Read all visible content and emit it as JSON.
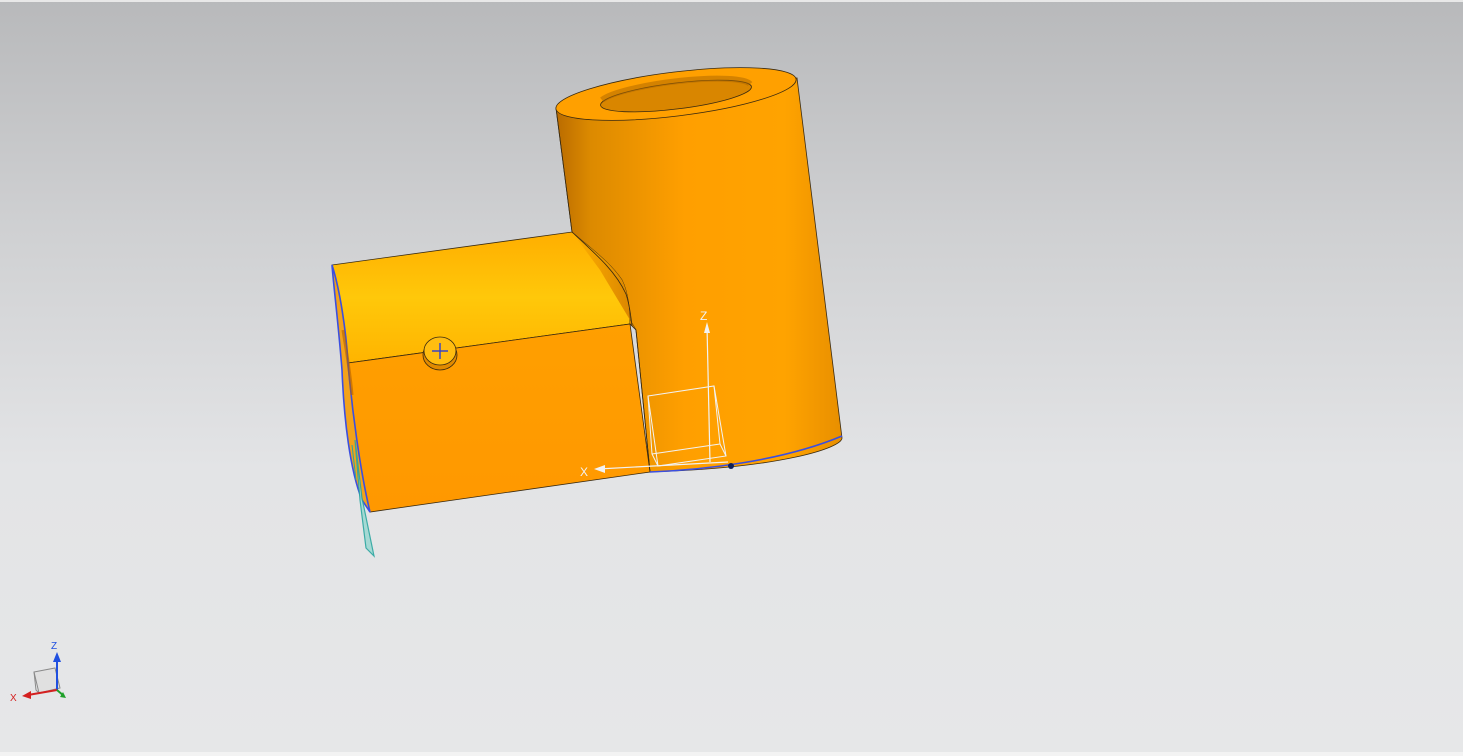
{
  "viewport": {
    "background_top": "#b8b9bb",
    "background_bottom": "#e6e7e8"
  },
  "model": {
    "body_color": "#ff9f00",
    "body_color_light": "#ffc40a",
    "body_color_shade": "#e08a00",
    "edge_color": "#3a2a10",
    "selection_edge_color": "#3b4fe0",
    "datum_plane_color": "#2aa6a0"
  },
  "work_csys": {
    "x_label": "X",
    "z_label": "Z",
    "color": "#ffffff"
  },
  "view_triad": {
    "x_label": "X",
    "z_label": "Z",
    "x_color": "#d42020",
    "y_color": "#1fa02a",
    "z_color": "#2050e0"
  },
  "hole_marker": {
    "icon": "crosshair-icon"
  }
}
